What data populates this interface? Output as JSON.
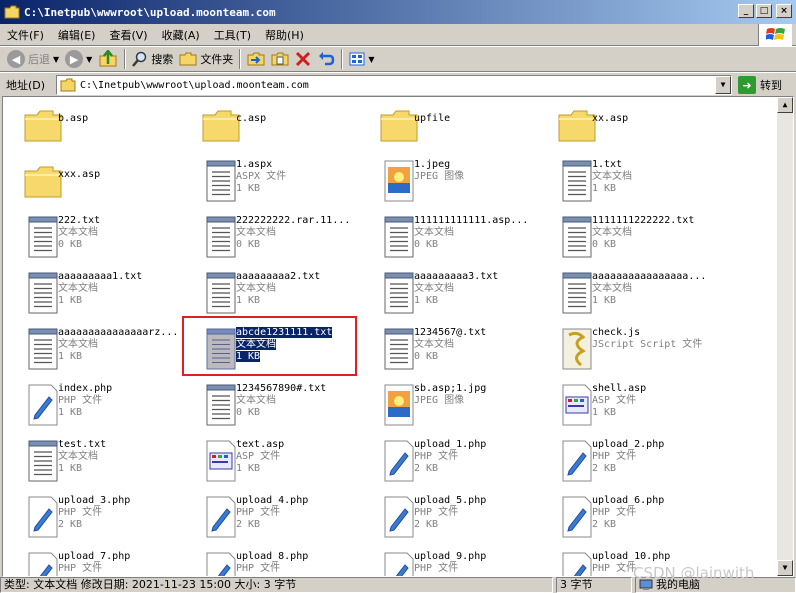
{
  "window": {
    "title": "C:\\Inetpub\\wwwroot\\upload.moonteam.com"
  },
  "menu": [
    "文件(F)",
    "编辑(E)",
    "查看(V)",
    "收藏(A)",
    "工具(T)",
    "帮助(H)"
  ],
  "toolbar": {
    "back": "后退",
    "search": "搜索",
    "folders": "文件夹"
  },
  "address": {
    "label": "地址(D)",
    "value": "C:\\Inetpub\\wwwroot\\upload.moonteam.com",
    "go": "转到"
  },
  "items": [
    {
      "name": "b.asp",
      "type": "",
      "size": "",
      "icon": "folder-icon"
    },
    {
      "name": "c.asp",
      "type": "",
      "size": "",
      "icon": "folder-icon"
    },
    {
      "name": "upfile",
      "type": "",
      "size": "",
      "icon": "folder-icon"
    },
    {
      "name": "xx.asp",
      "type": "",
      "size": "",
      "icon": "folder-icon"
    },
    {
      "name": "xxx.asp",
      "type": "",
      "size": "",
      "icon": "folder-icon"
    },
    {
      "name": "1.aspx",
      "type": "ASPX 文件",
      "size": "1 KB",
      "icon": "text-file-icon"
    },
    {
      "name": "1.jpeg",
      "type": "JPEG 图像",
      "size": "",
      "icon": "image-file-icon"
    },
    {
      "name": "1.txt",
      "type": "文本文档",
      "size": "1 KB",
      "icon": "text-file-icon"
    },
    {
      "name": "222.txt",
      "type": "文本文档",
      "size": "0 KB",
      "icon": "text-file-icon"
    },
    {
      "name": "222222222.rar.11...",
      "type": "文本文档",
      "size": "0 KB",
      "icon": "text-file-icon"
    },
    {
      "name": "111111111111.asp...",
      "type": "文本文档",
      "size": "0 KB",
      "icon": "text-file-icon"
    },
    {
      "name": "1111111222222.txt",
      "type": "文本文档",
      "size": "0 KB",
      "icon": "text-file-icon"
    },
    {
      "name": "aaaaaaaaa1.txt",
      "type": "文本文档",
      "size": "1 KB",
      "icon": "text-file-icon"
    },
    {
      "name": "aaaaaaaaa2.txt",
      "type": "文本文档",
      "size": "1 KB",
      "icon": "text-file-icon"
    },
    {
      "name": "aaaaaaaaa3.txt",
      "type": "文本文档",
      "size": "1 KB",
      "icon": "text-file-icon"
    },
    {
      "name": "aaaaaaaaaaaaaaaa...",
      "type": "文本文档",
      "size": "1 KB",
      "icon": "text-file-icon"
    },
    {
      "name": "aaaaaaaaaaaaaaarz...",
      "type": "文本文档",
      "size": "1 KB",
      "icon": "text-file-icon"
    },
    {
      "name": "abcde1231111.txt",
      "type": "文本文档",
      "size": "1 KB",
      "icon": "text-file-icon",
      "selected": true
    },
    {
      "name": "1234567@.txt",
      "type": "文本文档",
      "size": "0 KB",
      "icon": "text-file-icon"
    },
    {
      "name": "check.js",
      "type": "JScript Script 文件",
      "size": "",
      "icon": "script-file-icon"
    },
    {
      "name": "index.php",
      "type": "PHP 文件",
      "size": "1 KB",
      "icon": "php-file-icon"
    },
    {
      "name": "1234567890#.txt",
      "type": "文本文档",
      "size": "0 KB",
      "icon": "text-file-icon"
    },
    {
      "name": "sb.asp;1.jpg",
      "type": "JPEG 图像",
      "size": "",
      "icon": "image-file-icon"
    },
    {
      "name": "shell.asp",
      "type": "ASP 文件",
      "size": "1 KB",
      "icon": "asp-file-icon"
    },
    {
      "name": "test.txt",
      "type": "文本文档",
      "size": "1 KB",
      "icon": "text-file-icon"
    },
    {
      "name": "text.asp",
      "type": "ASP 文件",
      "size": "1 KB",
      "icon": "asp-file-icon"
    },
    {
      "name": "upload_1.php",
      "type": "PHP 文件",
      "size": "2 KB",
      "icon": "php-file-icon"
    },
    {
      "name": "upload_2.php",
      "type": "PHP 文件",
      "size": "2 KB",
      "icon": "php-file-icon"
    },
    {
      "name": "upload_3.php",
      "type": "PHP 文件",
      "size": "2 KB",
      "icon": "php-file-icon"
    },
    {
      "name": "upload_4.php",
      "type": "PHP 文件",
      "size": "2 KB",
      "icon": "php-file-icon"
    },
    {
      "name": "upload_5.php",
      "type": "PHP 文件",
      "size": "2 KB",
      "icon": "php-file-icon"
    },
    {
      "name": "upload_6.php",
      "type": "PHP 文件",
      "size": "2 KB",
      "icon": "php-file-icon"
    },
    {
      "name": "upload_7.php",
      "type": "PHP 文件",
      "size": "",
      "icon": "php-file-icon"
    },
    {
      "name": "upload_8.php",
      "type": "PHP 文件",
      "size": "",
      "icon": "php-file-icon"
    },
    {
      "name": "upload_9.php",
      "type": "PHP 文件",
      "size": "",
      "icon": "php-file-icon"
    },
    {
      "name": "upload_10.php",
      "type": "PHP 文件",
      "size": "",
      "icon": "php-file-icon"
    }
  ],
  "status": {
    "details": "类型: 文本文档 修改日期: 2021-11-23 15:00 大小: 3 字节",
    "size": "3 字节",
    "location": "我的电脑"
  },
  "watermark": "CSDN @lainwith"
}
